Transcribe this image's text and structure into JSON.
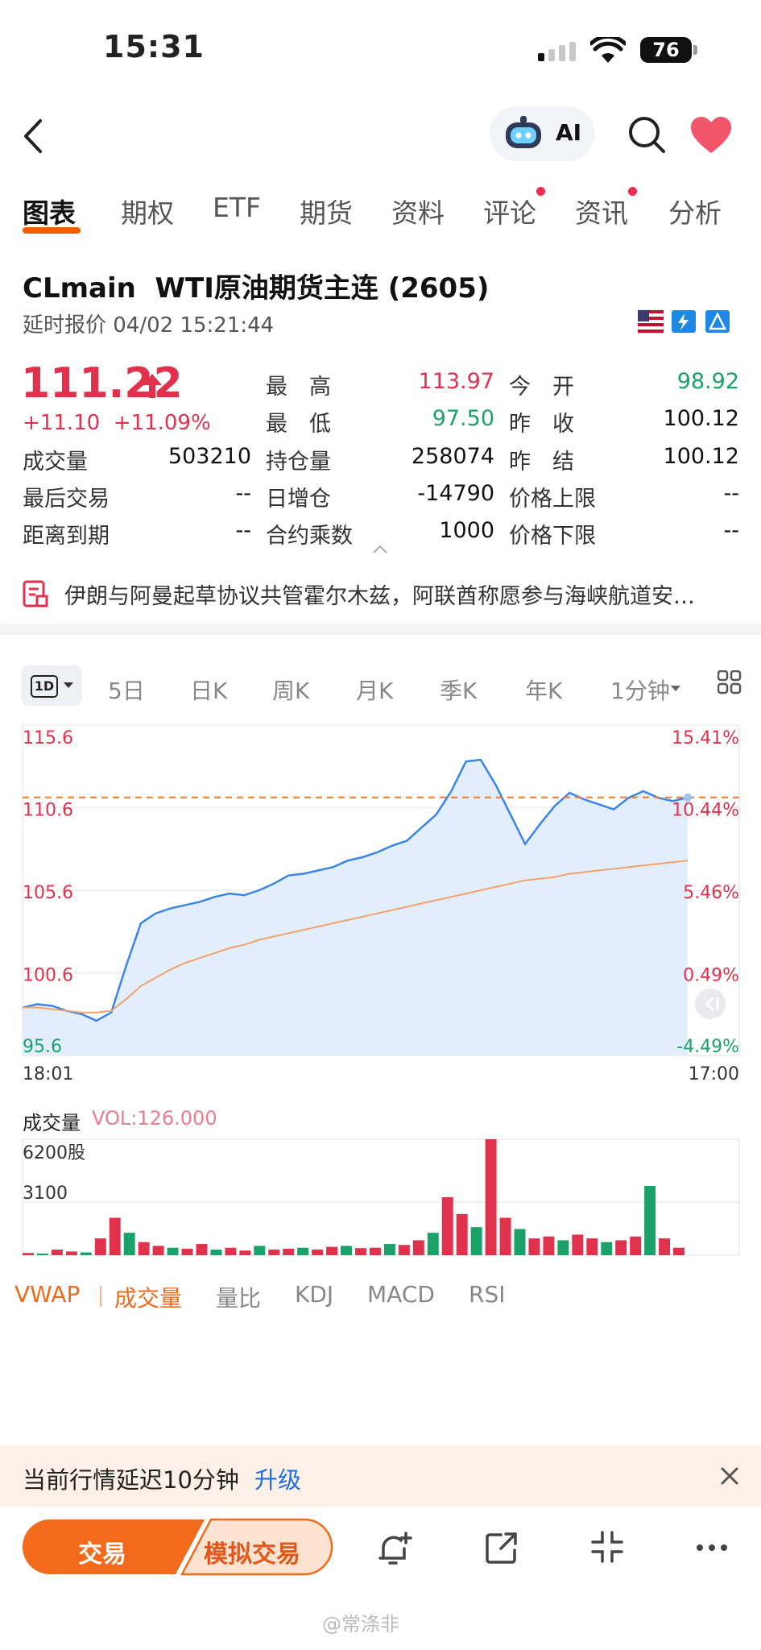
{
  "status": {
    "time": "15:31",
    "battery": "76"
  },
  "nav": {
    "ai_label": "AI"
  },
  "tabs": [
    {
      "label": "图表",
      "active": true,
      "dot": false
    },
    {
      "label": "期权",
      "active": false,
      "dot": false
    },
    {
      "label": "ETF",
      "active": false,
      "dot": false
    },
    {
      "label": "期货",
      "active": false,
      "dot": false
    },
    {
      "label": "资料",
      "active": false,
      "dot": false
    },
    {
      "label": "评论",
      "active": false,
      "dot": true
    },
    {
      "label": "资讯",
      "active": false,
      "dot": true
    },
    {
      "label": "分析",
      "active": false,
      "dot": false
    }
  ],
  "header": {
    "title": "CLmain  WTI原油期货主连 (2605)",
    "subtitle": "延时报价 04/02 15:21:44"
  },
  "quote": {
    "price": "111.22",
    "change": "+11.10  +11.09%",
    "rows": [
      [
        {
          "label": "最　高",
          "value": "113.97",
          "tone": "red"
        },
        {
          "label": "今　开",
          "value": "98.92",
          "tone": "green"
        }
      ],
      [
        {
          "label": "最　低",
          "value": "97.50",
          "tone": "green"
        },
        {
          "label": "昨　收",
          "value": "100.12",
          "tone": ""
        }
      ]
    ],
    "grid": [
      [
        {
          "label": "成交量",
          "value": "503210"
        },
        {
          "label": "持仓量",
          "value": "258074"
        },
        {
          "label": "昨　结",
          "value": "100.12"
        }
      ],
      [
        {
          "label": "最后交易",
          "value": "--"
        },
        {
          "label": "日增仓",
          "value": "-14790"
        },
        {
          "label": "价格上限",
          "value": "--"
        }
      ],
      [
        {
          "label": "距离到期",
          "value": "--"
        },
        {
          "label": "合约乘数",
          "value": "1000"
        },
        {
          "label": "价格下限",
          "value": "--"
        }
      ]
    ]
  },
  "news": {
    "text": "伊朗与阿曼起草协议共管霍尔木兹，阿联酋称愿参与海峡航道安…"
  },
  "chart_tabs": {
    "selected": "1D",
    "items": [
      "5日",
      "日K",
      "周K",
      "月K",
      "季K",
      "年K",
      "1分钟"
    ]
  },
  "chart_data": {
    "type": "line",
    "y_left_ticks": [
      "115.6",
      "110.6",
      "105.6",
      "100.6",
      "95.6"
    ],
    "y_right_ticks": [
      "15.41%",
      "10.44%",
      "5.46%",
      "0.49%",
      "-4.49%"
    ],
    "x_labels": [
      "18:01",
      "17:00"
    ],
    "ylim": [
      95.6,
      115.6
    ],
    "reference_price": 111.22,
    "series": [
      {
        "values": [
          98.5,
          98.7,
          98.6,
          98.3,
          98.1,
          97.7,
          98.2,
          101.0,
          103.6,
          104.2,
          104.5,
          104.7,
          104.9,
          105.2,
          105.4,
          105.3,
          105.6,
          106.0,
          106.5,
          106.6,
          106.8,
          107.0,
          107.4,
          107.6,
          107.9,
          108.3,
          108.6,
          109.4,
          110.2,
          111.6,
          113.4,
          113.5,
          112.0,
          110.2,
          108.4,
          109.6,
          110.7,
          111.5,
          111.1,
          110.8,
          110.5,
          111.2,
          111.6,
          111.2,
          111.0,
          111.22
        ]
      },
      {
        "values": [
          98.5,
          98.5,
          98.4,
          98.3,
          98.2,
          98.2,
          98.3,
          99.0,
          99.8,
          100.3,
          100.8,
          101.2,
          101.5,
          101.8,
          102.1,
          102.3,
          102.6,
          102.8,
          103.0,
          103.2,
          103.4,
          103.6,
          103.8,
          104.0,
          104.2,
          104.4,
          104.6,
          104.8,
          105.0,
          105.2,
          105.4,
          105.6,
          105.8,
          106.0,
          106.2,
          106.3,
          106.4,
          106.6,
          106.7,
          106.8,
          106.9,
          107.0,
          107.1,
          107.2,
          107.3,
          107.4
        ]
      }
    ]
  },
  "volume": {
    "label": "成交量",
    "vol_text": "VOL:126.000",
    "ticks": [
      "6200股",
      "3100"
    ],
    "max": 6200,
    "values": [
      120,
      90,
      300,
      200,
      150,
      900,
      2000,
      1200,
      700,
      500,
      400,
      350,
      600,
      300,
      400,
      250,
      500,
      300,
      350,
      400,
      300,
      450,
      500,
      380,
      400,
      600,
      550,
      800,
      1200,
      3100,
      2200,
      1500,
      6200,
      2000,
      1400,
      900,
      1000,
      800,
      1100,
      900,
      700,
      800,
      1000,
      3700,
      900,
      400
    ]
  },
  "indicators": [
    "VWAP",
    "成交量",
    "量比",
    "KDJ",
    "MACD",
    "RSI"
  ],
  "banner": {
    "text": "当前行情延迟10分钟",
    "link": "升级"
  },
  "bottom": {
    "trade": "交易",
    "sim_trade": "模拟交易"
  },
  "watermark": "@常涤非"
}
